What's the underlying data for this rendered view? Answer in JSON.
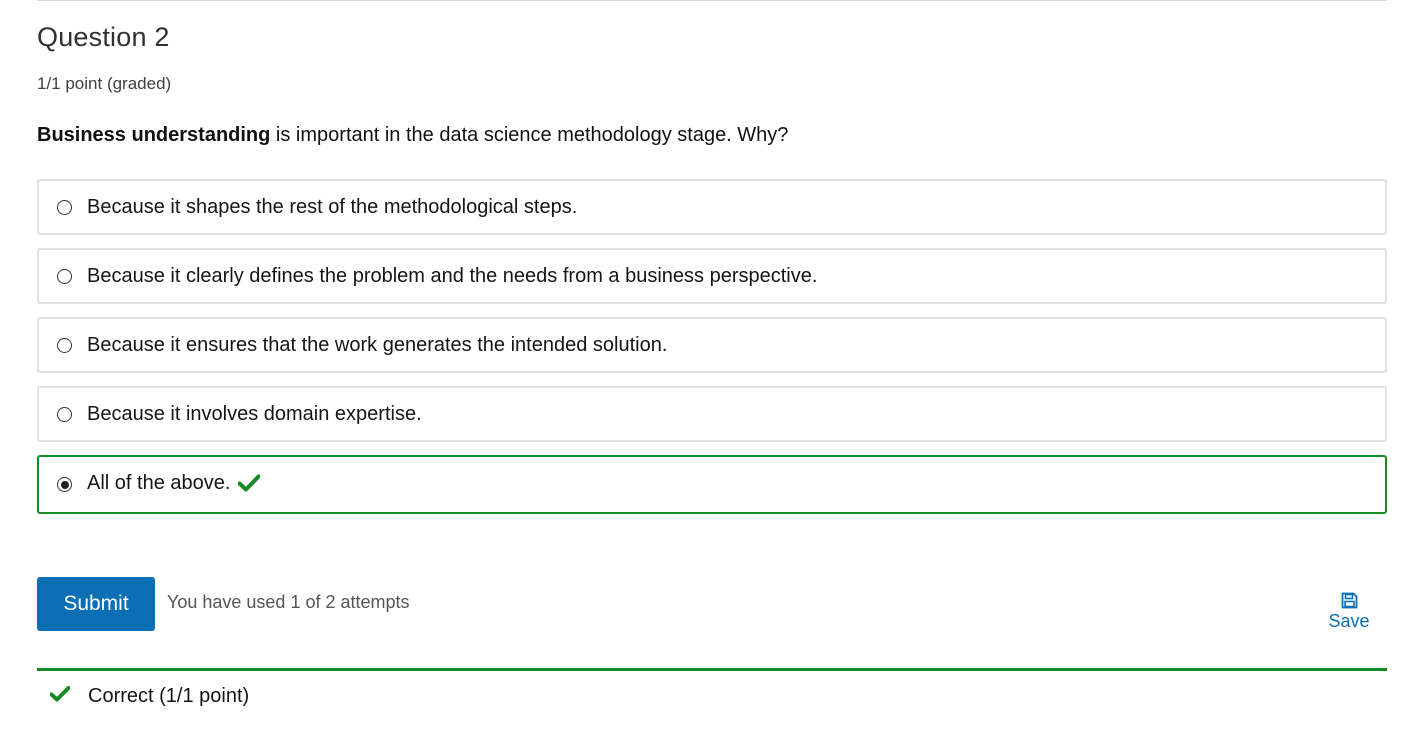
{
  "question": {
    "title": "Question 2",
    "points": "1/1 point (graded)",
    "prompt_bold": "Business understanding",
    "prompt_rest": " is important in the data science methodology stage. Why?"
  },
  "options": [
    {
      "label": "Because it shapes the rest of the methodological steps.",
      "selected": false
    },
    {
      "label": "Because it clearly defines the problem and the needs from a business perspective.",
      "selected": false
    },
    {
      "label": "Because it ensures that the work generates the intended solution.",
      "selected": false
    },
    {
      "label": "Because it involves domain expertise.",
      "selected": false
    },
    {
      "label": "All of the above.",
      "selected": true,
      "correct": true
    }
  ],
  "actions": {
    "submit_label": "Submit",
    "attempts_text": "You have used 1 of 2 attempts",
    "save_label": "Save"
  },
  "result": {
    "label": "Correct (1/1 point)"
  },
  "colors": {
    "accent": "#0a6fb5",
    "correct": "#178b25"
  },
  "icons": {
    "correct": "check-icon",
    "save": "floppy-disk-icon"
  }
}
